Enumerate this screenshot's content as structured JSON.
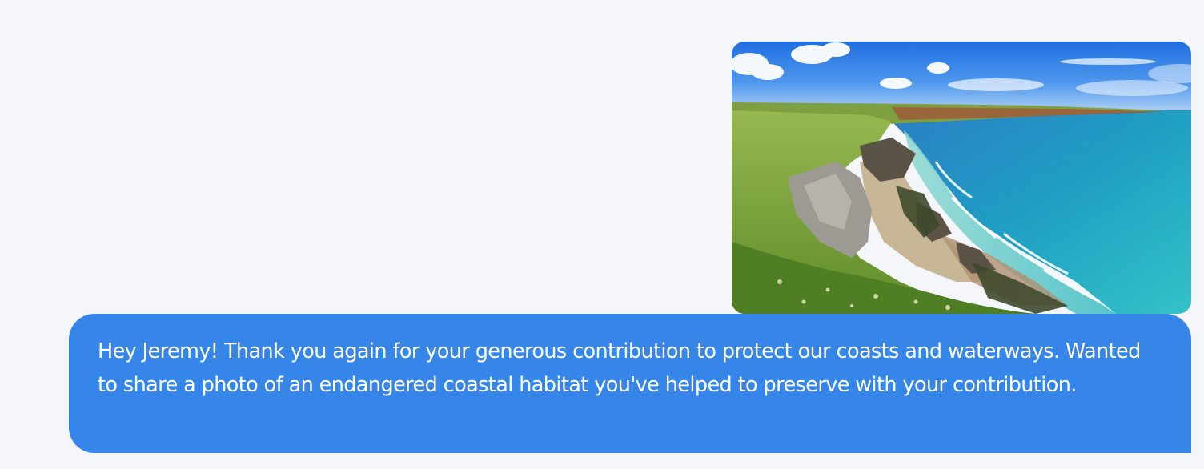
{
  "message": {
    "text": "Hey Jeremy! Thank you again for your generous contribution to protect our coasts and waterways. Wanted to share a photo of an endangered coastal habitat you've helped to preserve with your contribution."
  },
  "colors": {
    "page_background": "#f5f6fa",
    "bubble_background": "#3686ea",
    "bubble_text": "#ffffff"
  },
  "icons": {
    "photo": "coastal-habitat-photo"
  }
}
